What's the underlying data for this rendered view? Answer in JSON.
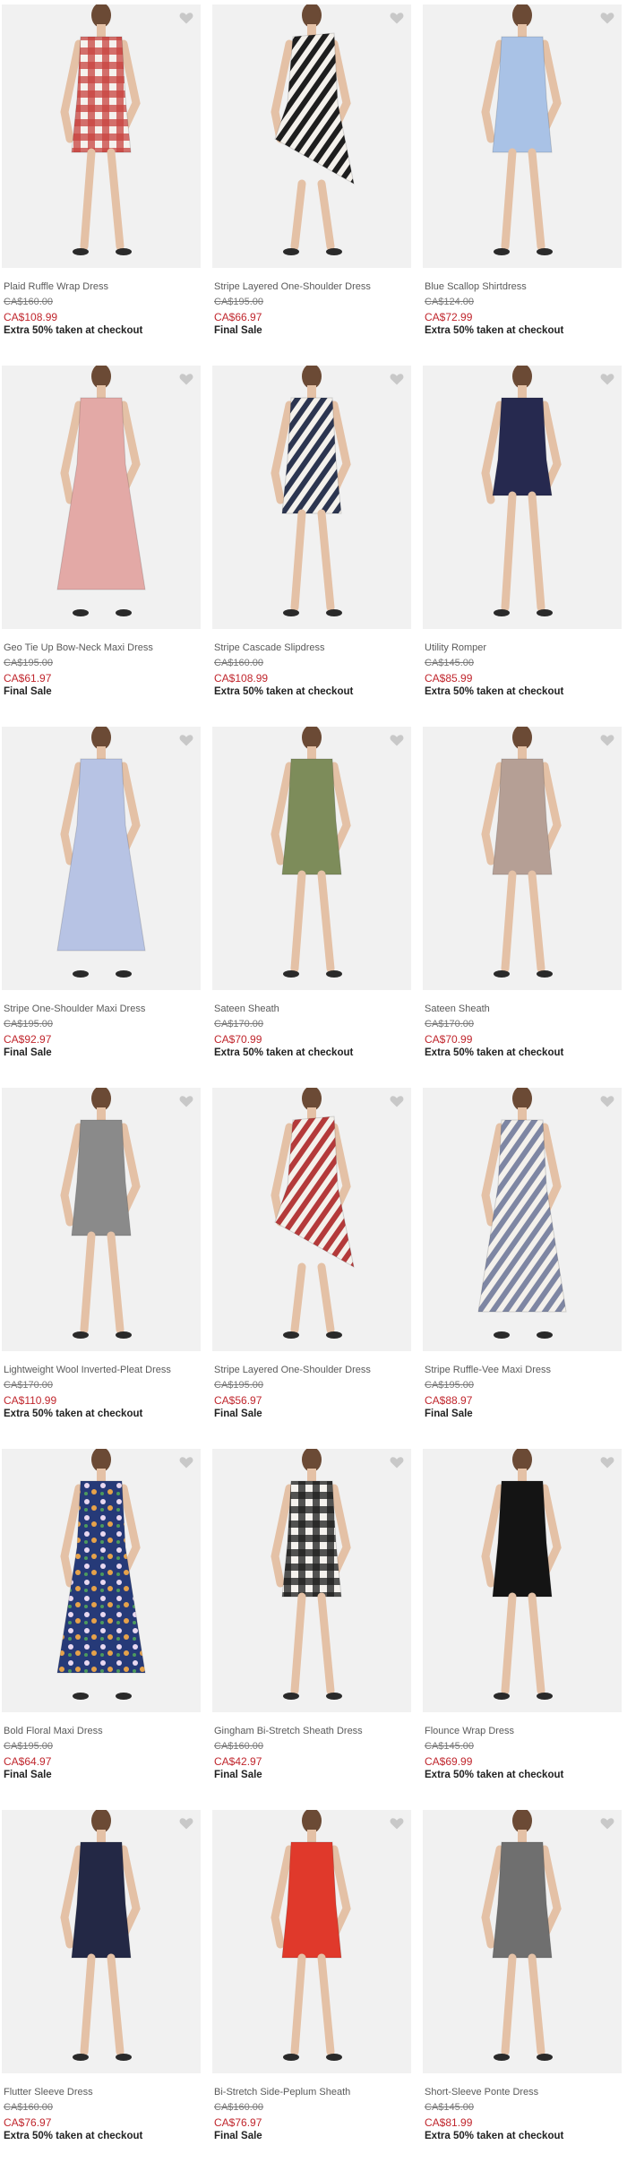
{
  "colors": {
    "background": "#ffffff",
    "photo_bg": "#f1f1f1",
    "sale_price": "#c0262d",
    "heart": "#c8c8c8"
  },
  "products": [
    {
      "name": "Plaid Ruffle Wrap Dress",
      "original_price": "CA$160.00",
      "sale_price": "CA$108.99",
      "promo": "Extra 50% taken at checkout",
      "dress_color": "#c8423f",
      "pattern": "plaid",
      "style": "knee"
    },
    {
      "name": "Stripe Layered One-Shoulder Dress",
      "original_price": "CA$195.00",
      "sale_price": "CA$66.97",
      "promo": "Final Sale",
      "dress_color": "#1e1e1e",
      "pattern": "stripe",
      "style": "asym"
    },
    {
      "name": "Blue Scallop Shirtdress",
      "original_price": "CA$124.00",
      "sale_price": "CA$72.99",
      "promo": "Extra 50% taken at checkout",
      "dress_color": "#a9c2e6",
      "pattern": "solid",
      "style": "knee"
    },
    {
      "name": "Geo Tie Up Bow-Neck Maxi Dress",
      "original_price": "CA$195.00",
      "sale_price": "CA$61.97",
      "promo": "Final Sale",
      "dress_color": "#e3a9a6",
      "pattern": "solid",
      "style": "maxi"
    },
    {
      "name": "Stripe Cascade Slipdress",
      "original_price": "CA$160.00",
      "sale_price": "CA$108.99",
      "promo": "Extra 50% taken at checkout",
      "dress_color": "#2c3550",
      "pattern": "stripe",
      "style": "knee"
    },
    {
      "name": "Utility Romper",
      "original_price": "CA$145.00",
      "sale_price": "CA$85.99",
      "promo": "Extra 50% taken at checkout",
      "dress_color": "#26294f",
      "pattern": "solid",
      "style": "short"
    },
    {
      "name": "Stripe One-Shoulder Maxi Dress",
      "original_price": "CA$195.00",
      "sale_price": "CA$92.97",
      "promo": "Final Sale",
      "dress_color": "#b7c3e4",
      "pattern": "solid",
      "style": "maxi"
    },
    {
      "name": "Sateen Sheath",
      "original_price": "CA$170.00",
      "sale_price": "CA$70.99",
      "promo": "Extra 50% taken at checkout",
      "dress_color": "#7d8c5a",
      "pattern": "solid",
      "style": "knee"
    },
    {
      "name": "Sateen Sheath",
      "original_price": "CA$170.00",
      "sale_price": "CA$70.99",
      "promo": "Extra 50% taken at checkout",
      "dress_color": "#b59f95",
      "pattern": "solid",
      "style": "knee"
    },
    {
      "name": "Lightweight Wool Inverted-Pleat Dress",
      "original_price": "CA$170.00",
      "sale_price": "CA$110.99",
      "promo": "Extra 50% taken at checkout",
      "dress_color": "#8a8a8a",
      "pattern": "solid",
      "style": "knee"
    },
    {
      "name": "Stripe Layered One-Shoulder Dress",
      "original_price": "CA$195.00",
      "sale_price": "CA$56.97",
      "promo": "Final Sale",
      "dress_color": "#b43a3a",
      "pattern": "stripe",
      "style": "asym"
    },
    {
      "name": "Stripe Ruffle-Vee Maxi Dress",
      "original_price": "CA$195.00",
      "sale_price": "CA$88.97",
      "promo": "Final Sale",
      "dress_color": "#7e86a3",
      "pattern": "stripe",
      "style": "maxi"
    },
    {
      "name": "Bold Floral Maxi Dress",
      "original_price": "CA$195.00",
      "sale_price": "CA$64.97",
      "promo": "Final Sale",
      "dress_color": "#263a78",
      "pattern": "floral",
      "style": "maxi"
    },
    {
      "name": "Gingham Bi-Stretch Sheath Dress",
      "original_price": "CA$160.00",
      "sale_price": "CA$42.97",
      "promo": "Final Sale",
      "dress_color": "#1c1c1c",
      "pattern": "plaid",
      "style": "knee"
    },
    {
      "name": "Flounce Wrap Dress",
      "original_price": "CA$145.00",
      "sale_price": "CA$69.99",
      "promo": "Extra 50% taken at checkout",
      "dress_color": "#141414",
      "pattern": "solid",
      "style": "knee"
    },
    {
      "name": "Flutter Sleeve Dress",
      "original_price": "CA$160.00",
      "sale_price": "CA$76.97",
      "promo": "Extra 50% taken at checkout",
      "dress_color": "#232845",
      "pattern": "solid",
      "style": "knee"
    },
    {
      "name": "Bi-Stretch Side-Peplum Sheath",
      "original_price": "CA$160.00",
      "sale_price": "CA$76.97",
      "promo": "Final Sale",
      "dress_color": "#e0392b",
      "pattern": "solid",
      "style": "knee"
    },
    {
      "name": "Short-Sleeve Ponte Dress",
      "original_price": "CA$145.00",
      "sale_price": "CA$81.99",
      "promo": "Extra 50% taken at checkout",
      "dress_color": "#6f6f6f",
      "pattern": "solid",
      "style": "knee"
    }
  ]
}
